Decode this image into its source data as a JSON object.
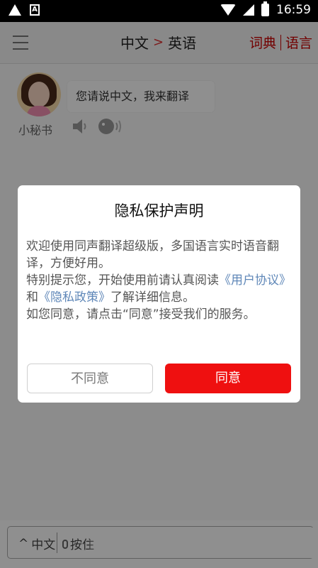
{
  "status_bar": {
    "time": "16:59",
    "a_badge": "A"
  },
  "app_bar": {
    "source_lang": "中文",
    "arrow": ">",
    "target_lang": "英语",
    "dictionary": "词典",
    "language": "语言"
  },
  "assistant": {
    "name": "小秘书",
    "message": "您请说中文，我来翻译"
  },
  "dialog": {
    "title": "隐私保护声明",
    "body_line1": "欢迎使用同声翻译超级版，多国语言实时语音翻译，方便好用。",
    "body_line2_prefix": "特别提示您，开始使用前请认真阅读",
    "user_agreement_link": "《用户协议》",
    "and_text": "和",
    "privacy_policy_link": "《隐私政策》",
    "body_line2_suffix": "了解详细信息。",
    "body_line3": "如您同意，请点击“同意”接受我们的服务。",
    "disagree_button": "不同意",
    "agree_button": "同意"
  },
  "bottom_bar": {
    "lang_label": "中文",
    "press_label": "按住"
  }
}
